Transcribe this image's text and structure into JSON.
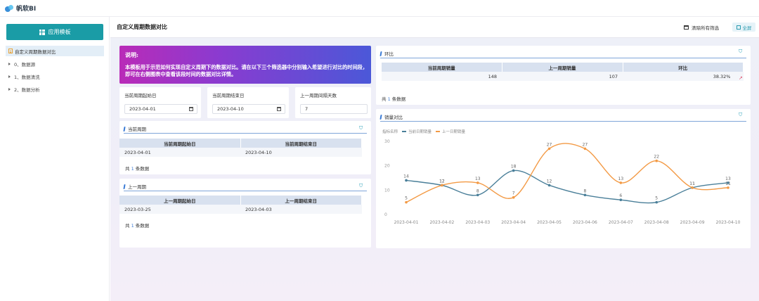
{
  "app": {
    "logo_text": "帆软BI"
  },
  "sidebar": {
    "apply_button": "应用模板",
    "active_item": "自定义周期数据对比",
    "items": [
      "0、数据源",
      "1、数据清洗",
      "2、数据分析"
    ]
  },
  "header": {
    "title": "自定义周期数据对比",
    "clear_filters": "清除所有筛选",
    "fullscreen": "全屏"
  },
  "description": {
    "title": "说明:",
    "body": "本模板用于示范如何实现自定义周期下的数据对比。请在以下三个筛选器中分别输入希望进行对比的时间段，即可在右侧图表中查看该段时间的数据对比详情。"
  },
  "filters": [
    {
      "label": "当前周期起始日",
      "value": "2023-04-01",
      "has_calendar": true
    },
    {
      "label": "当前周期结束日",
      "value": "2023-04-10",
      "has_calendar": true
    },
    {
      "label": "上一周期间隔天数",
      "value": "7",
      "has_calendar": false
    }
  ],
  "current_period": {
    "title": "当前周期",
    "headers": [
      "当前周期起始日",
      "当前周期结束日"
    ],
    "row": [
      "2023-04-01",
      "2023-04-10"
    ],
    "count_prefix": "共",
    "count": "1",
    "count_suffix": "条数据"
  },
  "previous_period": {
    "title": "上一周期",
    "headers": [
      "上一周期起始日",
      "上一周期结束日"
    ],
    "row": [
      "2023-03-25",
      "2023-04-03"
    ],
    "count_prefix": "共",
    "count": "1",
    "count_suffix": "条数据"
  },
  "ring_ratio": {
    "title": "环比",
    "headers": [
      "当前周期销量",
      "上一周期销量",
      "环比"
    ],
    "row": [
      "148",
      "107",
      "38.32%"
    ],
    "count_prefix": "共",
    "count": "1",
    "count_suffix": "条数据"
  },
  "sales_compare": {
    "title": "销量对比",
    "legend_prefix": "指标名称",
    "colors": {
      "current": "#4a7f99",
      "previous": "#f39a45"
    }
  },
  "chart_data": {
    "type": "line",
    "x": [
      "2023-04-01",
      "2023-04-02",
      "2023-04-03",
      "2023-04-04",
      "2023-04-05",
      "2023-04-06",
      "2023-04-07",
      "2023-04-08",
      "2023-04-09",
      "2023-04-10"
    ],
    "series": [
      {
        "name": "当前日期销量",
        "values": [
          14,
          12,
          8,
          18,
          12,
          8,
          6,
          5,
          11,
          13
        ]
      },
      {
        "name": "上一日期销量",
        "values": [
          5,
          12,
          13,
          7,
          27,
          27,
          13,
          22,
          11,
          11
        ]
      }
    ],
    "yticks": [
      0,
      10,
      20,
      30
    ],
    "ylim": [
      0,
      30
    ]
  }
}
